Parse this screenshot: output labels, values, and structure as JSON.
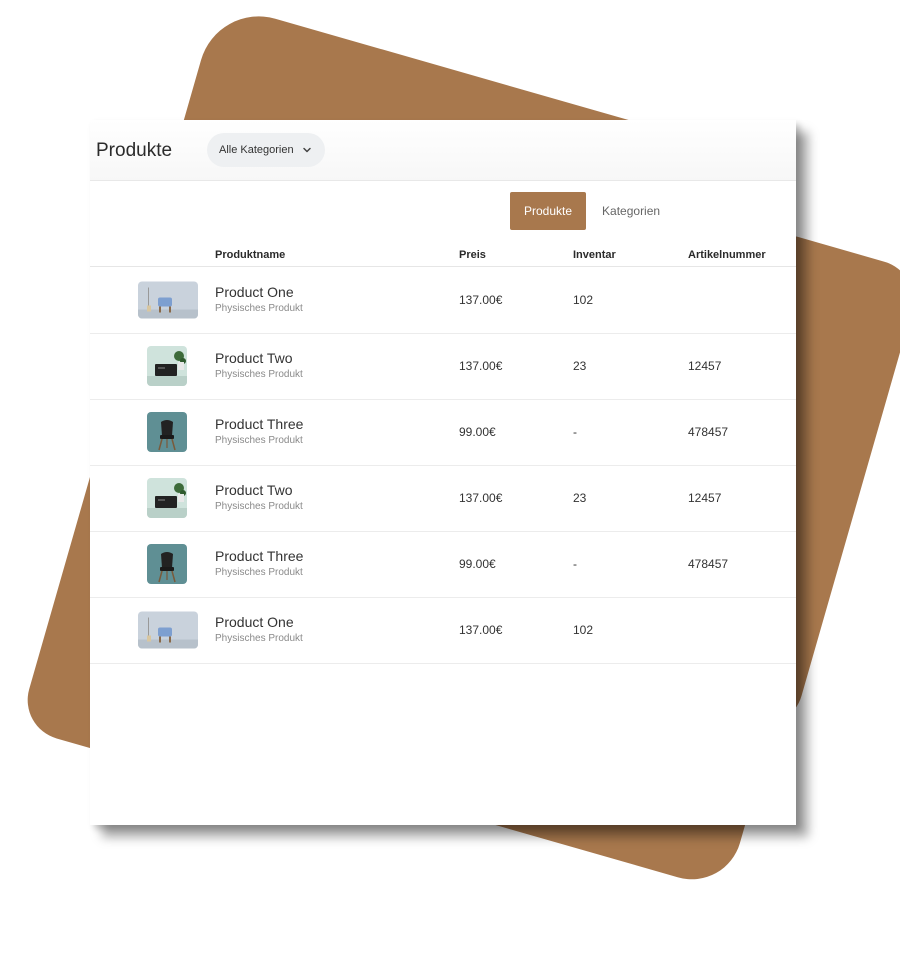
{
  "colors": {
    "accent": "#a8784d"
  },
  "header": {
    "title": "Produkte",
    "category_dropdown": {
      "selected": "Alle Kategorien",
      "icon": "chevron-down-icon"
    }
  },
  "tabs": [
    {
      "label": "Produkte",
      "active": true
    },
    {
      "label": "Kategorien",
      "active": false
    }
  ],
  "table": {
    "columns": [
      "Produktname",
      "Preis",
      "Inventar",
      "Artikelnummer"
    ],
    "rows": [
      {
        "name": "Product One",
        "type": "Physisches Produkt",
        "price": "137.00€",
        "inventory": "102",
        "sku": "",
        "thumb": "blue-chair-room-image"
      },
      {
        "name": "Product Two",
        "type": "Physisches Produkt",
        "price": "137.00€",
        "inventory": "23",
        "sku": "12457",
        "thumb": "black-cabinet-plant-image"
      },
      {
        "name": "Product Three",
        "type": "Physisches Produkt",
        "price": "99.00€",
        "inventory": "-",
        "sku": "478457",
        "thumb": "black-chair-image"
      },
      {
        "name": "Product Two",
        "type": "Physisches Produkt",
        "price": "137.00€",
        "inventory": "23",
        "sku": "12457",
        "thumb": "black-cabinet-plant-image"
      },
      {
        "name": "Product Three",
        "type": "Physisches Produkt",
        "price": "99.00€",
        "inventory": "-",
        "sku": "478457",
        "thumb": "black-chair-image"
      },
      {
        "name": "Product One",
        "type": "Physisches Produkt",
        "price": "137.00€",
        "inventory": "102",
        "sku": "",
        "thumb": "blue-chair-room-image"
      }
    ]
  }
}
